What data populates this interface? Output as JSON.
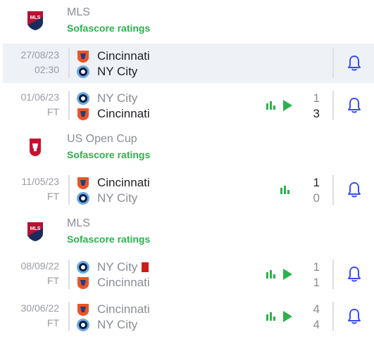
{
  "leagues": [
    {
      "name": "MLS",
      "ratings": "Sofascore ratings"
    },
    {
      "name": "US Open Cup",
      "ratings": "Sofascore ratings"
    },
    {
      "name": "MLS",
      "ratings": "Sofascore ratings"
    }
  ],
  "matches": [
    {
      "date": "27/08/23",
      "status": "02:30",
      "home": "Cincinnati",
      "away": "NY City",
      "home_score": "",
      "away_score": ""
    },
    {
      "date": "01/06/23",
      "status": "FT",
      "home": "NY City",
      "away": "Cincinnati",
      "home_score": "1",
      "away_score": "3"
    },
    {
      "date": "11/05/23",
      "status": "FT",
      "home": "Cincinnati",
      "away": "NY City",
      "home_score": "1",
      "away_score": "0"
    },
    {
      "date": "08/09/22",
      "status": "FT",
      "home": "NY City",
      "away": "Cincinnati",
      "home_score": "1",
      "away_score": "1"
    },
    {
      "date": "30/06/22",
      "status": "FT",
      "home": "Cincinnati",
      "away": "NY City",
      "home_score": "4",
      "away_score": "4"
    }
  ],
  "icons": {
    "league_logo_mls": "mls-logo-icon",
    "league_logo_cup": "us-open-cup-logo-icon",
    "stats": "stats-icon",
    "highlights": "play-icon",
    "notify": "bell-icon",
    "red_card": "red-card-icon"
  },
  "colors": {
    "accent_blue": "#374df5",
    "green": "#2bb24c",
    "red_card": "#d11b1b",
    "highlight_row": "#eef1f6"
  }
}
